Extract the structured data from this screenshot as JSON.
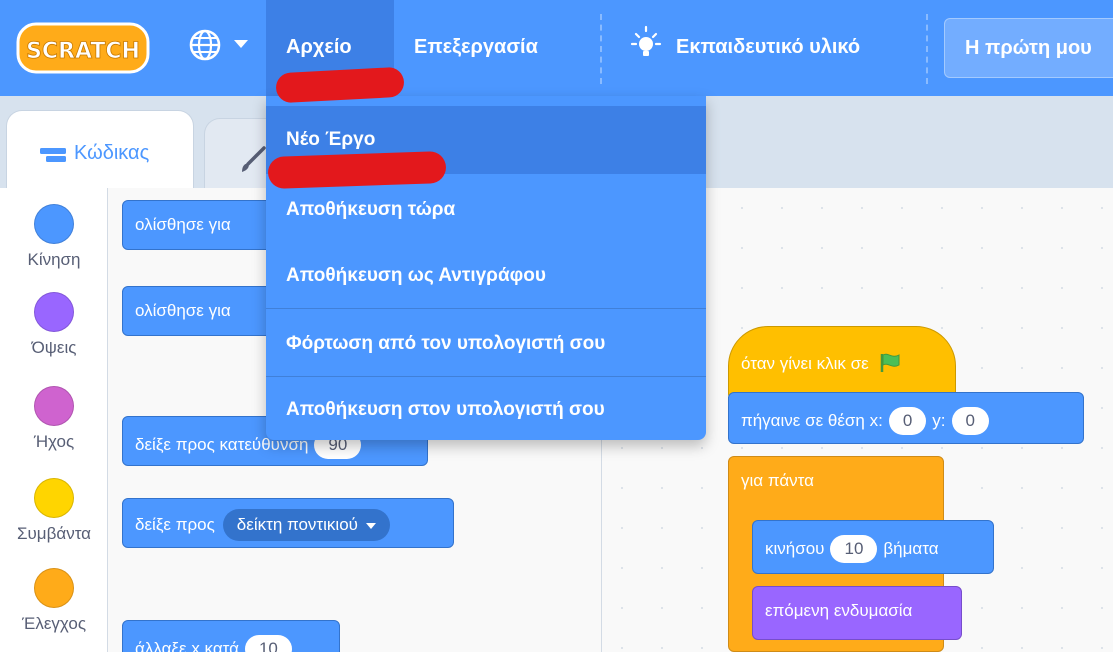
{
  "menubar": {
    "logo_text": "SCRATCH",
    "language_icon": "globe-icon",
    "file_label": "Αρχείο",
    "edit_label": "Επεξεργασία",
    "tutorials_icon": "lightbulb-icon",
    "tutorials_label": "Εκπαιδευτικό υλικό",
    "project_title": "Η πρώτη μου"
  },
  "file_menu": {
    "items": [
      "Νέο Έργο",
      "Αποθήκευση τώρα",
      "Αποθήκευση ως Αντιγράφου",
      "Φόρτωση από τον υπολογιστή σου",
      "Αποθήκευση στον υπολογιστή σου"
    ]
  },
  "tabs": {
    "code_label": "Κώδικας",
    "code_icon": "code-blocks-icon",
    "costumes_icon": "paintbrush-icon"
  },
  "categories": [
    {
      "label": "Κίνηση",
      "color": "#4c97ff"
    },
    {
      "label": "Όψεις",
      "color": "#9966ff"
    },
    {
      "label": "Ήχος",
      "color": "#cf63cf"
    },
    {
      "label": "Συμβάντα",
      "color": "#ffd500"
    },
    {
      "label": "Έλεγχος",
      "color": "#ffab19"
    }
  ],
  "palette": {
    "glide_1": "ολίσθησε για",
    "glide_2": "ολίσθησε για",
    "point_direction": "δείξε προς κατεύθυνση",
    "point_direction_value": "90",
    "point_towards": "δείξε προς",
    "point_towards_target": "δείκτη ποντικιού",
    "change_x": "άλλαξε x κατά",
    "change_x_value": "10"
  },
  "script": {
    "when_flag": "όταν γίνει κλικ σε",
    "goto_label": "πήγαινε σε θέση x:",
    "goto_x": "0",
    "goto_y_label": "y:",
    "goto_y": "0",
    "forever": "για πάντα",
    "move_label": "κινήσου",
    "move_steps": "10",
    "move_unit": "βήματα",
    "next_costume": "επόμενη ενδυμασία"
  },
  "colors": {
    "menubar": "#4c97ff",
    "motion": "#4c97ff",
    "looks": "#9966ff",
    "sound": "#cf63cf",
    "events": "#ffbf00",
    "control": "#ffab19",
    "annotation": "#e3181c"
  }
}
